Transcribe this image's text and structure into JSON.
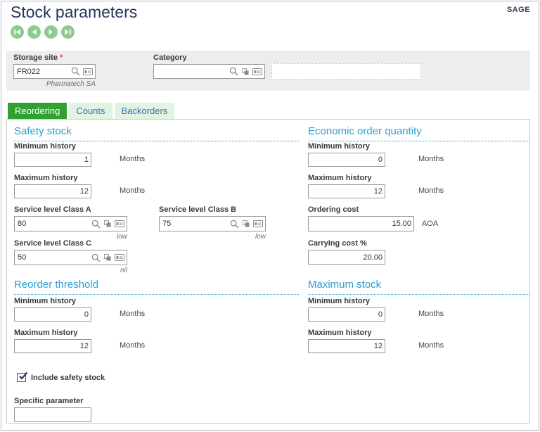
{
  "brand": "SAGE",
  "header": {
    "title": "Stock parameters",
    "nav": {
      "first": "first-record",
      "previous": "previous-record",
      "next": "next-record",
      "last": "last-record"
    }
  },
  "criteria": {
    "storage_site": {
      "label": "Storage site",
      "required_marker": "*",
      "value": "FR022",
      "hint": "Pharmatech SA"
    },
    "category": {
      "label": "Category",
      "value": ""
    },
    "description": {
      "value": ""
    }
  },
  "tabs": [
    {
      "label": "Reordering",
      "active": true
    },
    {
      "label": "Counts",
      "active": false
    },
    {
      "label": "Backorders",
      "active": false
    }
  ],
  "sections": {
    "safety_stock": {
      "title": "Safety stock",
      "minimum_history": {
        "label": "Minimum history",
        "value": "1",
        "unit": "Months"
      },
      "maximum_history": {
        "label": "Maximum history",
        "value": "12",
        "unit": "Months"
      },
      "service_level_a": {
        "label": "Service level Class A",
        "value": "80",
        "hint": "low"
      },
      "service_level_b": {
        "label": "Service level Class B",
        "value": "75",
        "hint": "low"
      },
      "service_level_c": {
        "label": "Service level Class C",
        "value": "50",
        "hint": "nil"
      }
    },
    "economic_order_quantity": {
      "title": "Economic order quantity",
      "minimum_history": {
        "label": "Minimum history",
        "value": "0",
        "unit": "Months"
      },
      "maximum_history": {
        "label": "Maximum history",
        "value": "12",
        "unit": "Months"
      },
      "ordering_cost": {
        "label": "Ordering cost",
        "value": "15.00",
        "unit": "AOA"
      },
      "carrying_cost": {
        "label": "Carrying cost %",
        "value": "20.00"
      }
    },
    "reorder_threshold": {
      "title": "Reorder threshold",
      "minimum_history": {
        "label": "Minimum history",
        "value": "0",
        "unit": "Months"
      },
      "maximum_history": {
        "label": "Maximum history",
        "value": "12",
        "unit": "Months"
      },
      "include_safety_stock": {
        "label": "Include safety stock",
        "checked": true
      },
      "specific_parameter": {
        "label": "Specific parameter",
        "value": ""
      }
    },
    "maximum_stock": {
      "title": "Maximum stock",
      "minimum_history": {
        "label": "Minimum history",
        "value": "0",
        "unit": "Months"
      },
      "maximum_history": {
        "label": "Maximum history",
        "value": "12",
        "unit": "Months"
      }
    }
  },
  "colors": {
    "accent_green": "#2fa232",
    "tab_inactive_bg": "#e2f3e2",
    "tab_inactive_text": "#3a70b5",
    "heading_blue": "#2aa0d8",
    "title_navy": "#24365a",
    "required_red": "#e0402f",
    "nav_button_green": "#8bcb8b"
  }
}
